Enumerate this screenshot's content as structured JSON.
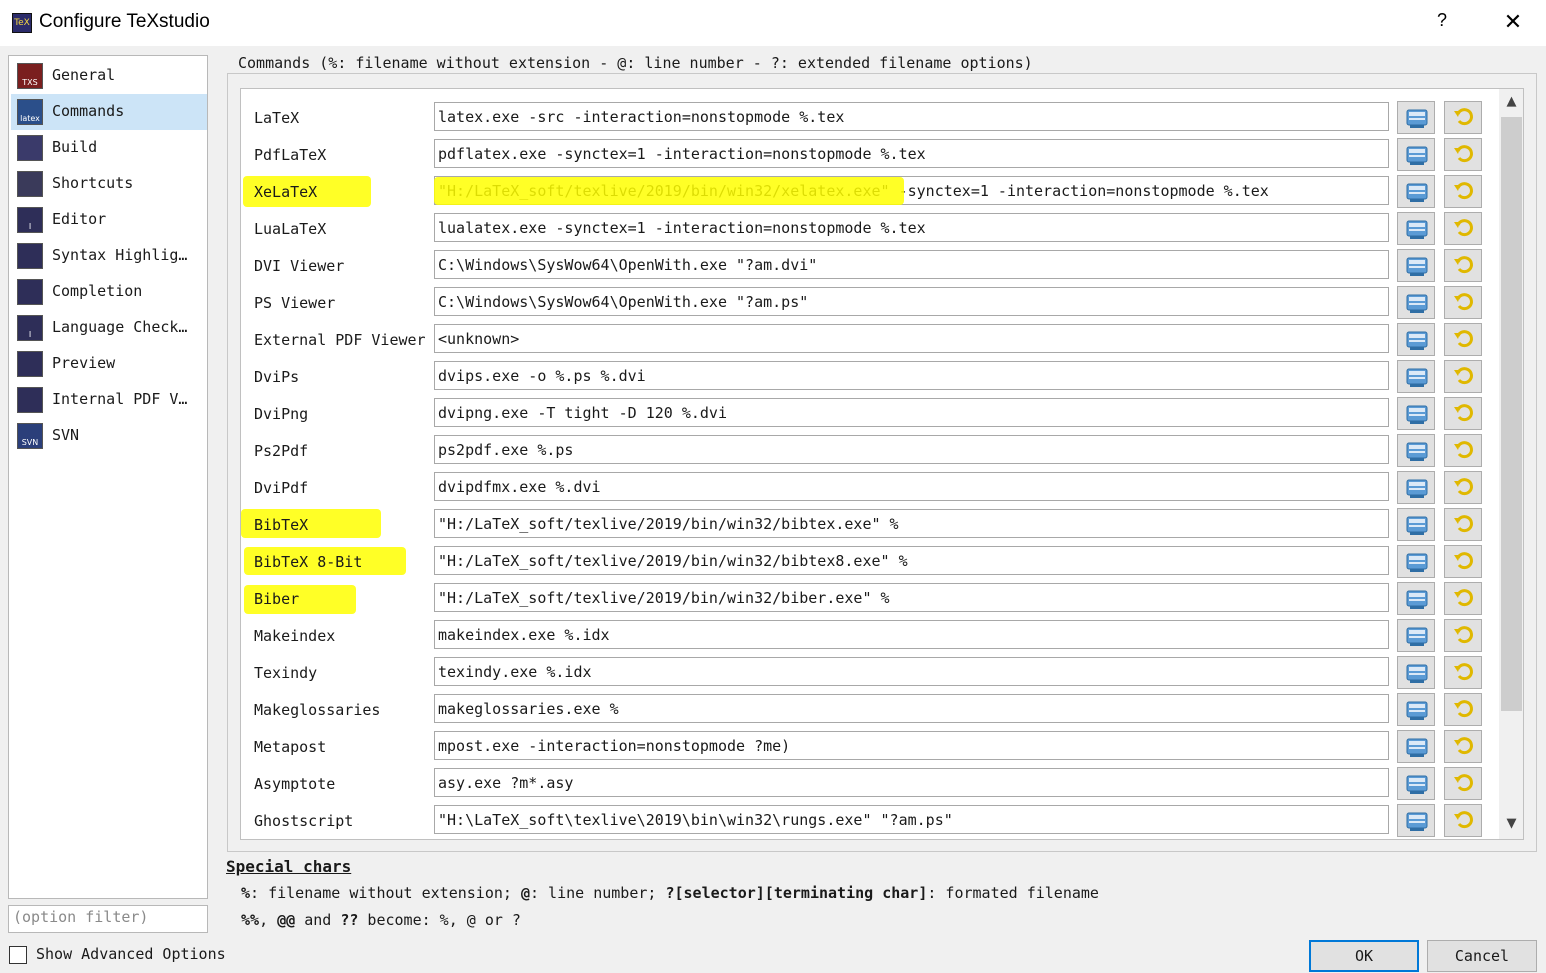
{
  "window": {
    "title": "Configure TeXstudio",
    "icon_text": "TeX",
    "help_label": "?",
    "close_label": "✕"
  },
  "sidebar": {
    "items": [
      {
        "label": "General",
        "icon": "txs-icon",
        "icon_text": "TXS",
        "icon_color": "#7a1f1f"
      },
      {
        "label": "Commands",
        "icon": "latex-icon",
        "icon_text": "latex",
        "icon_color": "#2b4f8a"
      },
      {
        "label": "Build",
        "icon": "build-icon",
        "icon_text": "",
        "icon_color": "#3a3a6a"
      },
      {
        "label": "Shortcuts",
        "icon": "keyboard-icon",
        "icon_text": "",
        "icon_color": "#3a3a5a"
      },
      {
        "label": "Editor",
        "icon": "editor-icon",
        "icon_text": "I",
        "icon_color": "#2e2e58"
      },
      {
        "label": "Syntax Highlig…",
        "icon": "syntax-highlighting-icon",
        "icon_text": "",
        "icon_color": "#2e2e58"
      },
      {
        "label": "Completion",
        "icon": "completion-icon",
        "icon_text": "",
        "icon_color": "#2e2e58"
      },
      {
        "label": "Language Check…",
        "icon": "language-check-icon",
        "icon_text": "I",
        "icon_color": "#2e2e58"
      },
      {
        "label": "Preview",
        "icon": "preview-icon",
        "icon_text": "",
        "icon_color": "#2e2e58"
      },
      {
        "label": "Internal PDF V…",
        "icon": "pdf-viewer-icon",
        "icon_text": "",
        "icon_color": "#2e2e58"
      },
      {
        "label": "SVN",
        "icon": "svn-icon",
        "icon_text": "SVN",
        "icon_color": "#2b3f7a"
      }
    ],
    "active_index": 1,
    "filter_placeholder": "(option filter)",
    "show_advanced_label": "Show Advanced Options",
    "show_advanced_checked": false
  },
  "commands": {
    "group_title": "Commands (%: filename without extension - @: line number - ?: extended filename options)",
    "rows": [
      {
        "label": "LaTeX",
        "value": "latex.exe -src -interaction=nonstopmode %.tex"
      },
      {
        "label": "PdfLaTeX",
        "value": "pdflatex.exe -synctex=1 -interaction=nonstopmode %.tex"
      },
      {
        "label": "XeLaTeX",
        "value": "\"H:/LaTeX_soft/texlive/2019/bin/win32/xelatex.exe\" -synctex=1 -interaction=nonstopmode %.tex"
      },
      {
        "label": "LuaLaTeX",
        "value": "lualatex.exe -synctex=1 -interaction=nonstopmode %.tex"
      },
      {
        "label": "DVI Viewer",
        "value": "C:\\Windows\\SysWow64\\OpenWith.exe \"?am.dvi\""
      },
      {
        "label": "PS Viewer",
        "value": "C:\\Windows\\SysWow64\\OpenWith.exe \"?am.ps\""
      },
      {
        "label": "External PDF Viewer",
        "value": "<unknown>"
      },
      {
        "label": "DviPs",
        "value": "dvips.exe -o %.ps %.dvi"
      },
      {
        "label": "DviPng",
        "value": "dvipng.exe -T tight -D 120 %.dvi"
      },
      {
        "label": "Ps2Pdf",
        "value": "ps2pdf.exe %.ps"
      },
      {
        "label": "DviPdf",
        "value": "dvipdfmx.exe %.dvi"
      },
      {
        "label": "BibTeX",
        "value": "\"H:/LaTeX_soft/texlive/2019/bin/win32/bibtex.exe\" %"
      },
      {
        "label": "BibTeX 8-Bit",
        "value": "\"H:/LaTeX_soft/texlive/2019/bin/win32/bibtex8.exe\" %"
      },
      {
        "label": "Biber",
        "value": "\"H:/LaTeX_soft/texlive/2019/bin/win32/biber.exe\" %"
      },
      {
        "label": "Makeindex",
        "value": "makeindex.exe %.idx"
      },
      {
        "label": "Texindy",
        "value": "texindy.exe %.idx"
      },
      {
        "label": "Makeglossaries",
        "value": "makeglossaries.exe %"
      },
      {
        "label": "Metapost",
        "value": "mpost.exe -interaction=nonstopmode ?me)"
      },
      {
        "label": "Asymptote",
        "value": "asy.exe ?m*.asy"
      },
      {
        "label": "Ghostscript",
        "value": "\"H:\\LaTeX_soft\\texlive\\2019\\bin\\win32\\rungs.exe\" \"?am.ps\""
      }
    ],
    "highlight_color": "#ffff00",
    "scroll_up": "▲",
    "scroll_down": "▼"
  },
  "special_chars": {
    "title": "Special chars",
    "line1": [
      {
        "text": "%",
        "bold": true
      },
      {
        "text": ": filename without extension; ",
        "bold": false
      },
      {
        "text": "@",
        "bold": true
      },
      {
        "text": ": line number; ",
        "bold": false
      },
      {
        "text": "?[selector][terminating char]",
        "bold": true
      },
      {
        "text": ": formated filename",
        "bold": false
      }
    ],
    "line2": [
      {
        "text": "%%",
        "bold": true
      },
      {
        "text": ", ",
        "bold": false
      },
      {
        "text": "@@",
        "bold": true
      },
      {
        "text": " and ",
        "bold": false
      },
      {
        "text": "??",
        "bold": true
      },
      {
        "text": " become: %, @ or ?",
        "bold": false
      }
    ]
  },
  "buttons": {
    "ok": "OK",
    "cancel": "Cancel"
  }
}
